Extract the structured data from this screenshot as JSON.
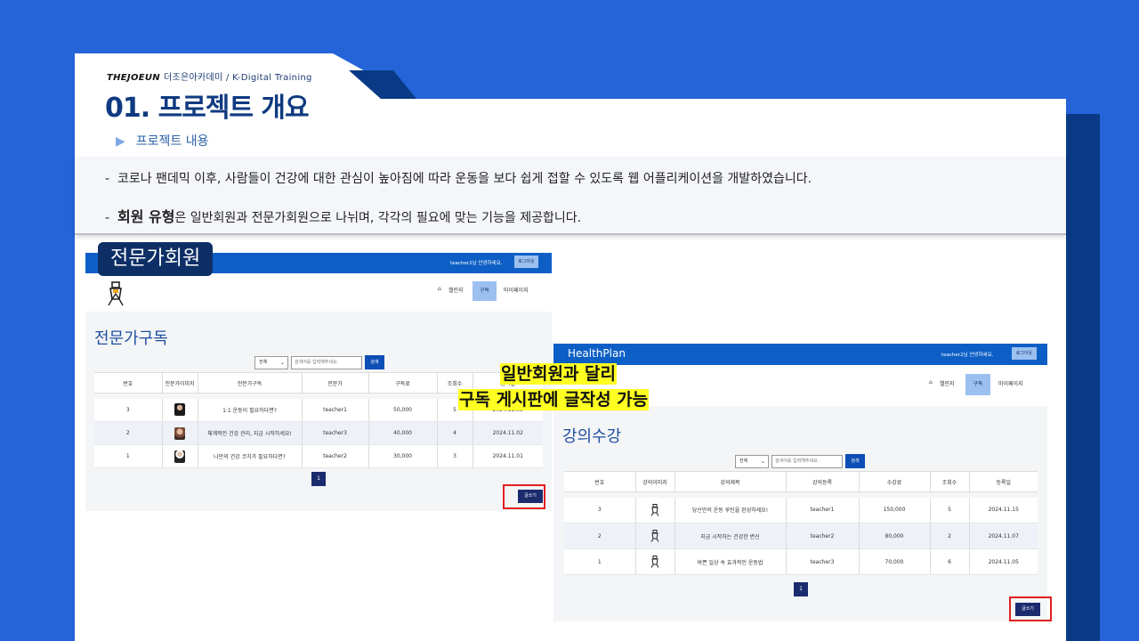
{
  "slide": {
    "brand_logo": "THEJOEUN",
    "brand_text": "더조은아카데미 / K-Digital Training",
    "title": "01. 프로젝트 개요",
    "subtitle": "프로젝트 내용",
    "bullet1": "코로나 팬데믹 이후, 사람들이 건강에 대한 관심이 높아짐에 따라 운동을 보다 쉽게 접할 수 있도록 웹 어플리케이션을 개발하였습니다.",
    "bullet2_bold": "회원 유형",
    "bullet2_rest": "은  일반회원과 전문가회원으로 나뉘며, 각각의 필요에 맞는 기능을 제공합니다.",
    "dash": "-",
    "label_expert": "전문가회원",
    "callout_line1": "일반회원과 달리",
    "callout_line2": "구독 게시판에 글작성 가능"
  },
  "left_mock": {
    "greeting": "teacher2님 안녕하세요.",
    "logout": "로그아웃",
    "nav": {
      "home_icon": "home-icon",
      "challenge": "챌린지",
      "subscribe": "구독",
      "mypage": "마이페이지"
    },
    "page_title": "전문가구독",
    "search": {
      "select": "전체",
      "placeholder": "검색어를 입력해주세요.",
      "button": "검색"
    },
    "columns": [
      "번호",
      "전문가이미지",
      "전문가구독",
      "전문가",
      "구독료",
      "조회수",
      "등록일"
    ],
    "rows": [
      {
        "no": "3",
        "title": "1:1 운동이 필요하다면?",
        "expert": "teacher1",
        "fee": "50,000",
        "views": "5",
        "date": "2024.11.05"
      },
      {
        "no": "2",
        "title": "체계적인 건강 관리, 지금 시작하세요!",
        "expert": "teacher3",
        "fee": "40,000",
        "views": "4",
        "date": "2024.11.02"
      },
      {
        "no": "1",
        "title": "나만의 건강 코치가 필요하다면?",
        "expert": "teacher2",
        "fee": "30,000",
        "views": "3",
        "date": "2024.11.01"
      }
    ],
    "page": "1",
    "write_button": "글쓰기"
  },
  "right_mock": {
    "app_name": "HealthPlan",
    "greeting": "teacher2님 안녕하세요.",
    "logout": "로그아웃",
    "nav": {
      "home_icon": "home-icon",
      "challenge": "챌린지",
      "subscribe": "구독",
      "mypage": "마이페이지"
    },
    "page_title": "강의수강",
    "search": {
      "select": "전체",
      "placeholder": "검색어를 입력해주세요.",
      "button": "검색"
    },
    "columns": [
      "번호",
      "강의이미지",
      "강의제목",
      "강의등록",
      "수강료",
      "조회수",
      "등록일"
    ],
    "rows": [
      {
        "no": "3",
        "title": "당신만의 운동 루틴을 완성하세요!",
        "teacher": "teacher1",
        "fee": "150,000",
        "views": "5",
        "date": "2024.11.15"
      },
      {
        "no": "2",
        "title": "지금 시작하는 건강한 변신",
        "teacher": "teacher2",
        "fee": "80,000",
        "views": "2",
        "date": "2024.11.07"
      },
      {
        "no": "1",
        "title": "바쁜 일상 속 효과적인 운동법",
        "teacher": "teacher3",
        "fee": "70,000",
        "views": "6",
        "date": "2024.11.05"
      }
    ],
    "page": "1",
    "write_button": "글쓰기"
  },
  "colors": {
    "accent": "#2464d8",
    "navy": "#0d2f66",
    "topbar": "#0d5fc6",
    "highlight": "#ffff22",
    "red": "#e02020"
  }
}
